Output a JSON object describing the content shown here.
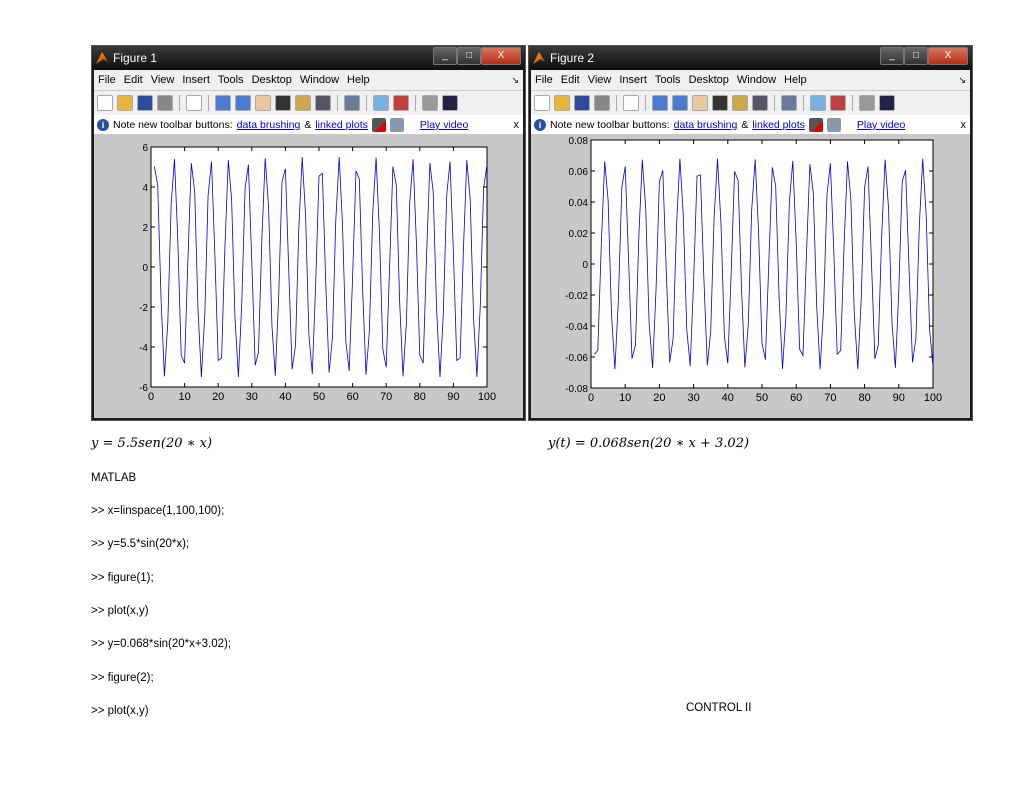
{
  "figures": [
    {
      "title": "Figure 1",
      "menu": [
        "File",
        "Edit",
        "View",
        "Insert",
        "Tools",
        "Desktop",
        "Window",
        "Help"
      ],
      "note": {
        "text": "Note new toolbar buttons:",
        "link1": "data brushing",
        "amp": "&",
        "link2": "linked plots",
        "video": "Play video",
        "close": "x"
      }
    },
    {
      "title": "Figure 2",
      "menu": [
        "File",
        "Edit",
        "View",
        "Insert",
        "Tools",
        "Desktop",
        "Window",
        "Help"
      ],
      "note": {
        "text": "Note new toolbar buttons:",
        "link1": "data brushing",
        "amp": "&",
        "link2": "linked plots",
        "video": "Play video",
        "close": "x"
      }
    }
  ],
  "chart_data": [
    {
      "type": "line",
      "title": "",
      "xlabel": "",
      "ylabel": "",
      "function": "y=5.5*sin(20*x)",
      "amplitude": 5.5,
      "frequency": 20,
      "phase": 0,
      "x_start": 1,
      "x_end": 100,
      "n_points": 100,
      "xlim": [
        0,
        100
      ],
      "ylim": [
        -6,
        6
      ],
      "xticks": [
        "0",
        "10",
        "20",
        "30",
        "40",
        "50",
        "60",
        "70",
        "80",
        "90",
        "100"
      ],
      "yticks": [
        "6",
        "4",
        "2",
        "0",
        "-2",
        "-4",
        "-6"
      ],
      "color": "#0000cc"
    },
    {
      "type": "line",
      "title": "",
      "xlabel": "",
      "ylabel": "",
      "function": "y=0.068*sin(20*x+3.02)",
      "amplitude": 0.068,
      "frequency": 20,
      "phase": 3.02,
      "x_start": 1,
      "x_end": 100,
      "n_points": 100,
      "xlim": [
        0,
        100
      ],
      "ylim": [
        -0.08,
        0.08
      ],
      "xticks": [
        "0",
        "10",
        "20",
        "30",
        "40",
        "50",
        "60",
        "70",
        "80",
        "90",
        "100"
      ],
      "yticks": [
        "0.08",
        "0.06",
        "0.04",
        "0.02",
        "0",
        "-0.02",
        "-0.04",
        "-0.06",
        "-0.08"
      ],
      "color": "#0000cc"
    }
  ],
  "doc": {
    "eq1": "y = 5.5sen(20 ∗ x)",
    "eq2": "y(t) = 0.068sen(20 ∗ x + 3.02)",
    "heading": "MATLAB",
    "commands": [
      ">> x=linspace(1,100,100);",
      ">> y=5.5*sin(20*x);",
      ">> figure(1);",
      ">> plot(x,y)",
      ">> y=0.068*sin(20*x+3.02);",
      ">> figure(2);",
      ">> plot(x,y)"
    ],
    "footer": "CONTROL II"
  }
}
